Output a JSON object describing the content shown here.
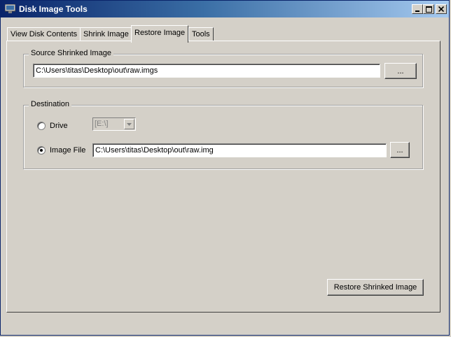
{
  "window": {
    "title": "Disk Image Tools",
    "controls": {
      "minimize": "minimize",
      "maximize": "maximize",
      "close": "close"
    }
  },
  "tabs": [
    {
      "label": "View Disk Contents",
      "active": false
    },
    {
      "label": "Shrink Image",
      "active": false
    },
    {
      "label": "Restore Image",
      "active": true
    },
    {
      "label": "Tools",
      "active": false
    }
  ],
  "source": {
    "legend": "Source Shrinked Image",
    "path": "C:\\Users\\titas\\Desktop\\out\\raw.imgs",
    "browse_label": "..."
  },
  "destination": {
    "legend": "Destination",
    "drive_label": "Drive",
    "drive_value": "[E:\\]",
    "drive_selected": false,
    "image_file_label": "Image File",
    "image_file_selected": true,
    "image_file_path": "C:\\Users\\titas\\Desktop\\out\\raw.img",
    "browse_label": "..."
  },
  "actions": {
    "restore_label": "Restore Shrinked Image"
  },
  "colors": {
    "face": "#d4d0c8",
    "title_start": "#0a246a",
    "title_end": "#a6caf0"
  }
}
